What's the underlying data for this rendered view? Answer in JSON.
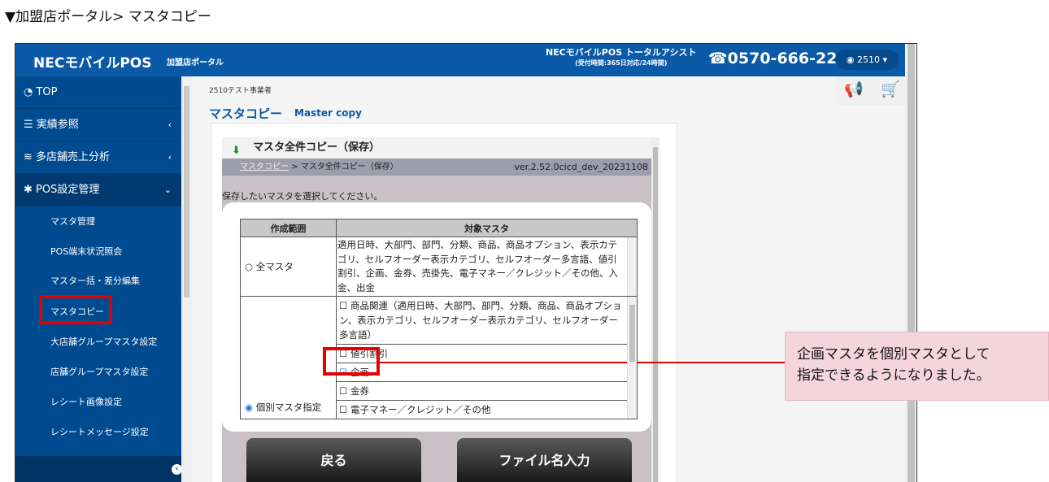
{
  "caption": "▼加盟店ポータル> マスタコピー",
  "header": {
    "brand": "NECモバイルPOS",
    "brand_sub": "加盟店ポータル",
    "assist": "NECモバイルPOS トータルアシスト",
    "assist_hours": "(受付時間:365日対応/24時間)",
    "phone": "0570-666-221",
    "user": "2510"
  },
  "sidebar": {
    "items": [
      {
        "label": "TOP",
        "icon": "dashboard-icon"
      },
      {
        "label": "実績参照",
        "icon": "list-icon"
      },
      {
        "label": "多店舗売上分析",
        "icon": "database-icon"
      },
      {
        "label": "POS設定管理",
        "icon": "gear-icon"
      }
    ],
    "sub_items": [
      "マスタ管理",
      "POS端末状況照会",
      "マスター括・差分編集",
      "マスタコピー",
      "大店舗グループマスタ設定",
      "店舗グループマスタ設定",
      "レシート画像設定",
      "レシートメッセージ設定"
    ]
  },
  "main": {
    "business": "2510テスト事業者",
    "title": "マスタコピー",
    "title_en": "Master copy"
  },
  "dialog": {
    "title": "マスタ全件コピー（保存）",
    "crumb_link": "マスタコピー",
    "crumb_rest": " > マスタ全件コピー（保存）",
    "version": "ver.2.52.0cicd_dev_20231108",
    "prompt": "保存したいマスタを選択してください。",
    "table": {
      "headers": [
        "作成範囲",
        "対象マスタ"
      ],
      "all_label": "全マスタ",
      "all_desc": "適用日時、大部門、部門、分類、商品、商品オプション、表示カテゴリ、セルフオーダー表示カテゴリ、セルフオーダー多言語、値引割引、企画、金券、売掛先、電子マネー／クレジット／その他、入金、出金",
      "indiv_label": "個別マスタ指定",
      "options": [
        {
          "label": "商品関連（適用日時、大部門、部門、分類、商品、商品オプション、表示カテゴリ、セルフオーダー表示カテゴリ、セルフオーダー多言語）",
          "checked": false
        },
        {
          "label": "値引割引",
          "checked": false
        },
        {
          "label": "企画",
          "checked": true
        },
        {
          "label": "金券",
          "checked": false
        },
        {
          "label": "電子マネー／クレジット／その他",
          "checked": false
        },
        {
          "label": "売掛先",
          "checked": false
        }
      ],
      "selected_scope": "個別マスタ指定"
    },
    "back": "戻る",
    "next": "ファイル名入力"
  },
  "callout": {
    "line1": "企画マスタを個別マスタとして",
    "line2": "指定できるようになりました。"
  },
  "colors": {
    "header": "#0a5aa8",
    "sidebar": "#004a8f",
    "highlight": "#e60000",
    "callout": "#f4d5de"
  }
}
